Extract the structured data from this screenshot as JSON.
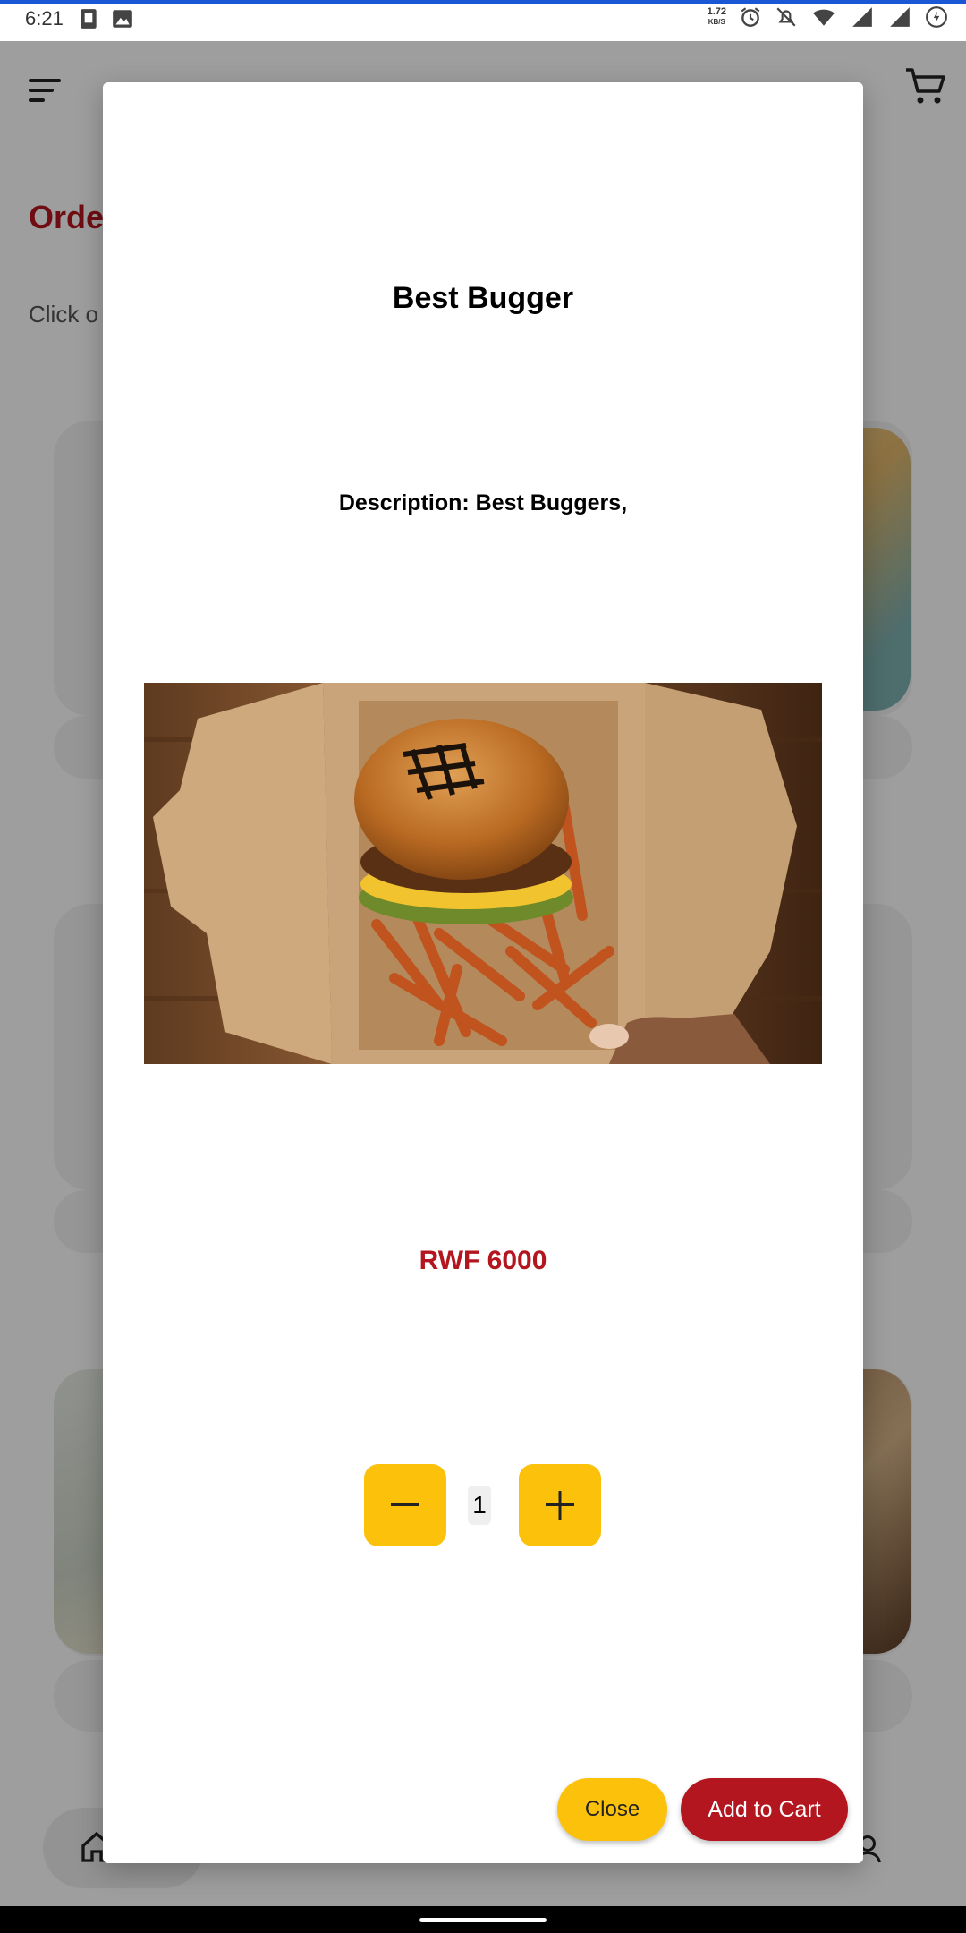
{
  "status_bar": {
    "time": "6:21",
    "net_speed_value": "1.72",
    "net_speed_unit": "KB/S",
    "icons": [
      "sim-card-icon",
      "image-icon",
      "alarm-icon",
      "notifications-off-icon",
      "wifi-icon",
      "signal-r-icon",
      "signal-icon",
      "battery-icon"
    ]
  },
  "background": {
    "title_partial": "Orde",
    "hint_partial": "Click o"
  },
  "modal": {
    "title": "Best Bugger",
    "description": "Description: Best Buggers,",
    "image_alt": "burger-with-fries-in-box",
    "price": "RWF 6000",
    "quantity": "1",
    "close_label": "Close",
    "add_to_cart_label": "Add to Cart"
  },
  "colors": {
    "accent_red": "#b3161f",
    "accent_yellow": "#fcc10a",
    "status_line_blue": "#1a56d6"
  }
}
